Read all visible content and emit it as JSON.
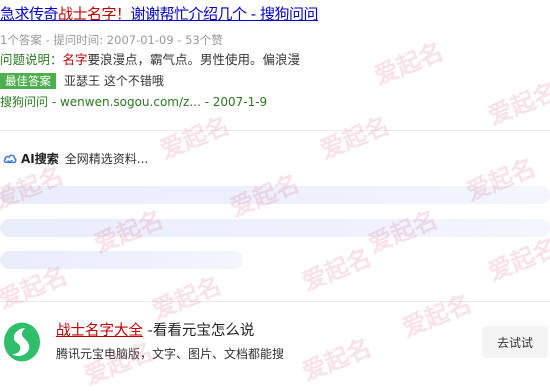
{
  "result": {
    "title_prefix": "急求传奇",
    "title_highlight": "战士名字！",
    "title_suffix": "谢谢帮忙介绍几个 - 搜狗问问",
    "meta": "1个答案 - 提问时间: 2007-01-09 - 53个赞",
    "question_label": "问题说明：",
    "question_highlight": "名字",
    "question_text": "要浪漫点，霸气点。男性使用。偏浪漫",
    "best_badge": "最佳答案",
    "best_text": "亚瑟王  这个不错哦",
    "source": "搜狗问问 - wenwen.sogou.com/z... - 2007-1-9"
  },
  "ai": {
    "name": "AI搜索",
    "text": "全网精选资料...",
    "icon": "cloud-icon",
    "accent": "#3b7bf5"
  },
  "app": {
    "logo": "yuanbao-logo-icon",
    "title_link": "战士名字大全",
    "title_rest": " -看看元宝怎么说",
    "desc": "腾讯元宝电脑版，文字、图片、文档都能搜",
    "button": "去试试"
  },
  "watermark": "爱起名",
  "colors": {
    "link": "#0000cc",
    "highlight": "#c00000",
    "green": "#2a7a1f",
    "badge": "#4cae4c"
  }
}
